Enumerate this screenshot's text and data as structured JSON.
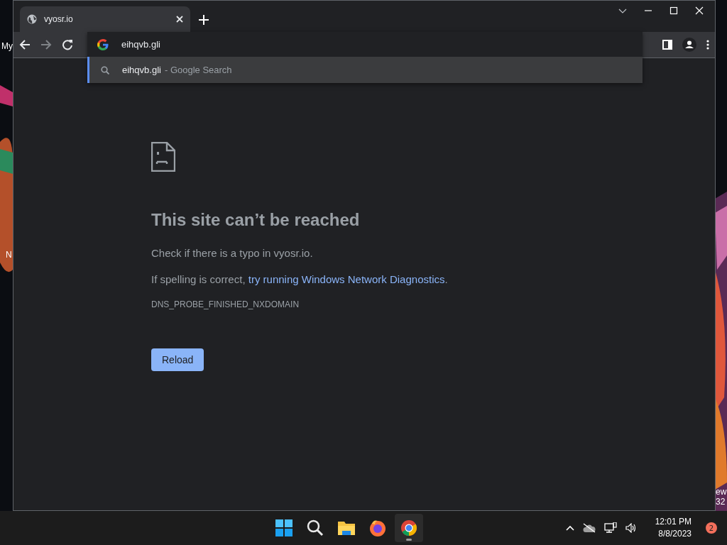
{
  "desktop": {
    "left_labels": [
      "My",
      "N"
    ],
    "right_labels": [
      "ew",
      "32"
    ]
  },
  "browser": {
    "tabs": [
      {
        "title": "vyosr.io",
        "selected": true
      }
    ],
    "omnibox": {
      "value": "eihqvb.gli"
    },
    "suggestions": [
      {
        "query": "eihqvb.gli",
        "suffix": "- Google Search",
        "selected": true
      }
    ],
    "page": {
      "heading": "This site can’t be reached",
      "hint": "Check if there is a typo in vyosr.io.",
      "sentence_start": "If spelling is correct, ",
      "link": "try running Windows Network Diagnostics",
      "sentence_end": ".",
      "error_code": "DNS_PROBE_FINISHED_NXDOMAIN",
      "button": "Reload"
    }
  },
  "taskbar": {
    "apps": [
      {
        "kind": "start",
        "selected": false
      },
      {
        "kind": "search",
        "selected": false
      },
      {
        "kind": "files",
        "selected": false
      },
      {
        "kind": "firefox",
        "selected": false
      },
      {
        "kind": "chrome",
        "selected": true
      }
    ],
    "time": "12:01 PM",
    "date": "8/8/2023",
    "badge": "2"
  }
}
